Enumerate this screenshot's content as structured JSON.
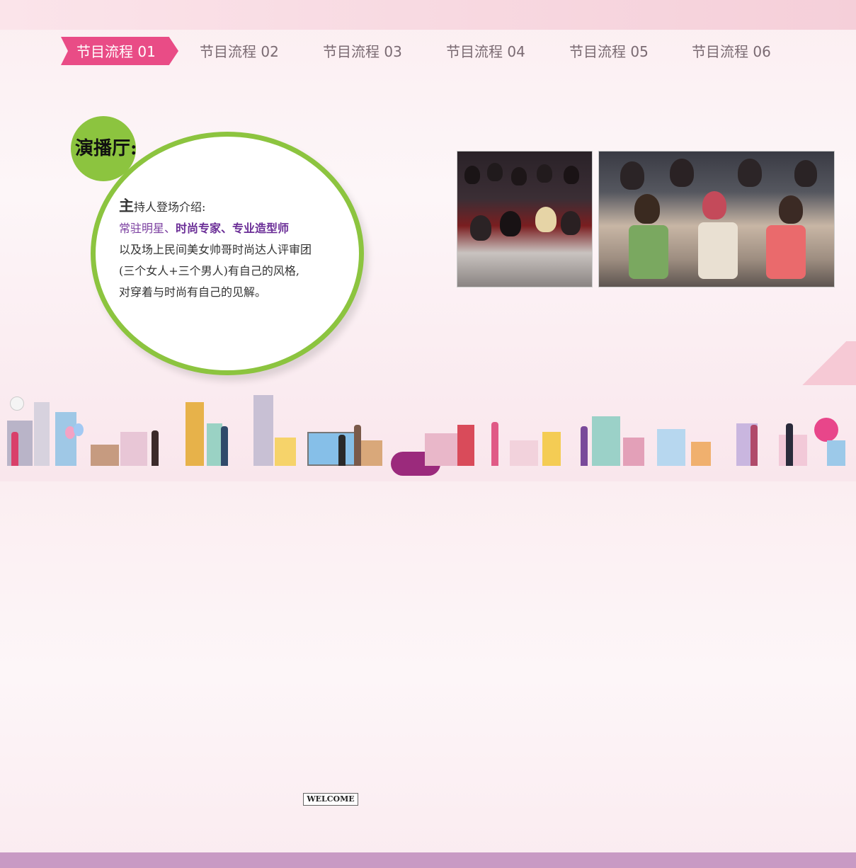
{
  "nav": {
    "tabs": [
      {
        "label": "节目流程  01",
        "active": true
      },
      {
        "label": "节目流程  02",
        "active": false
      },
      {
        "label": "节目流程  03",
        "active": false
      },
      {
        "label": "节目流程  04",
        "active": false
      },
      {
        "label": "节目流程  05",
        "active": false
      },
      {
        "label": "节目流程  06",
        "active": false
      }
    ]
  },
  "section": {
    "title": "演播厅:",
    "lead_char": "主",
    "line1_rest": "持人登场介绍:",
    "line2": {
      "a": "常驻明星、",
      "b": "时尚专家、",
      "c": "专业造型师"
    },
    "line3": "以及场上民间美女帅哥时尚达人评审团",
    "line4": "(三个女人+三个男人)有自己的风格,",
    "line5": "对穿着与时尚有自己的见解。"
  },
  "decor": {
    "welcome_sign": "WELCOME"
  },
  "colors": {
    "accent_pink": "#e94c86",
    "accent_green": "#8cc43f",
    "purple": "#6b2e97"
  }
}
